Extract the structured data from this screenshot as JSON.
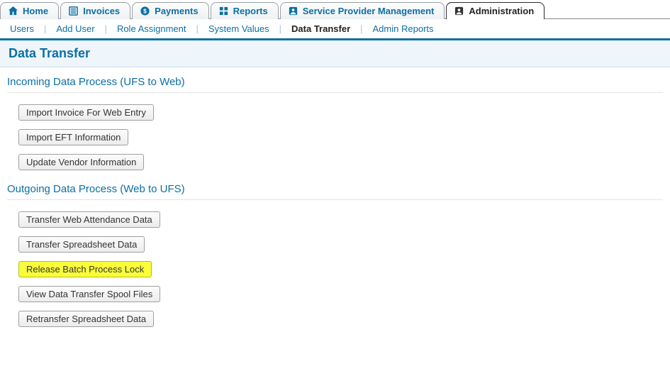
{
  "tabs": [
    {
      "label": "Home",
      "icon": "home"
    },
    {
      "label": "Invoices",
      "icon": "doc"
    },
    {
      "label": "Payments",
      "icon": "coin"
    },
    {
      "label": "Reports",
      "icon": "grid"
    },
    {
      "label": "Service Provider Management",
      "icon": "person"
    },
    {
      "label": "Administration",
      "icon": "person",
      "active": true
    }
  ],
  "subnav": [
    {
      "label": "Users"
    },
    {
      "label": "Add User"
    },
    {
      "label": "Role Assignment"
    },
    {
      "label": "System Values"
    },
    {
      "label": "Data Transfer",
      "active": true
    },
    {
      "label": "Admin Reports"
    }
  ],
  "page_title": "Data Transfer",
  "sections": {
    "incoming": {
      "heading": "Incoming Data Process (UFS to Web)",
      "buttons": [
        "Import Invoice For Web Entry",
        "Import EFT Information",
        "Update Vendor Information"
      ]
    },
    "outgoing": {
      "heading": "Outgoing Data Process (Web to UFS)",
      "buttons": [
        "Transfer Web Attendance Data",
        "Transfer Spreadsheet Data",
        "Release Batch Process Lock",
        "View Data Transfer Spool Files",
        "Retransfer Spreadsheet Data"
      ],
      "highlight": "Release Batch Process Lock"
    }
  }
}
